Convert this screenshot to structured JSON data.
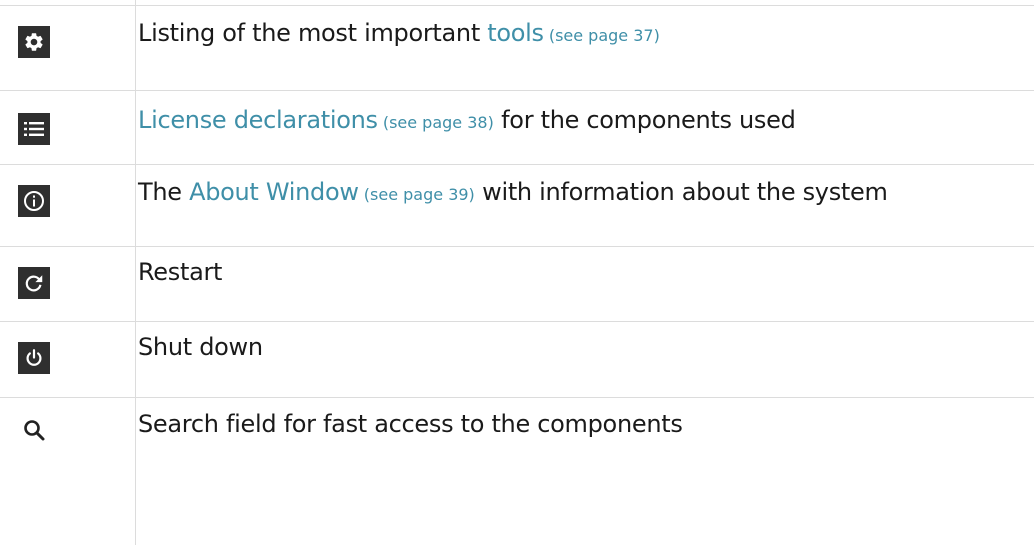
{
  "rows": [
    {
      "icon": "gear-icon",
      "text_before": "Listing of the most important ",
      "link_text": "tools",
      "ref": " (see page 37)",
      "text_after": ""
    },
    {
      "icon": "list-icon",
      "text_before": "",
      "link_text": "License declarations",
      "ref": " (see page 38)",
      "text_after": " for the components used"
    },
    {
      "icon": "info-icon",
      "text_before": "The ",
      "link_text": "About Window",
      "ref": " (see page 39)",
      "text_after": " with information about the system"
    },
    {
      "icon": "restart-icon",
      "text": "Restart"
    },
    {
      "icon": "power-icon",
      "text": "Shut down"
    },
    {
      "icon": "search-icon",
      "text": "Search field for fast access to the components"
    }
  ],
  "colors": {
    "link": "#3f8fa8",
    "icon_background": "#2f2f2f",
    "grid": "#dcdcdc"
  }
}
